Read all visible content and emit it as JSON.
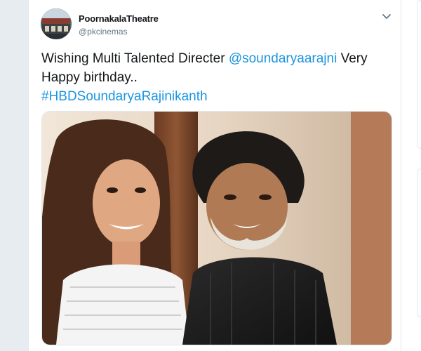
{
  "tweet": {
    "display_name": "PoornakalaTheatre",
    "handle": "@pkcinemas",
    "text_intro": "Wishing Multi Talented Directer ",
    "mention": "@soundaryaarajni",
    "text_outro": " Very Happy birthday..",
    "hashtag": "#HBDSoundaryaRajinikanth",
    "avatar_icon": "theatre-building-avatar",
    "menu_icon": "chevron-down-icon",
    "media_description": ""
  },
  "colors": {
    "link": "#1b95e0",
    "text": "#14171a",
    "secondary": "#657786",
    "background": "#e6ecf0"
  }
}
